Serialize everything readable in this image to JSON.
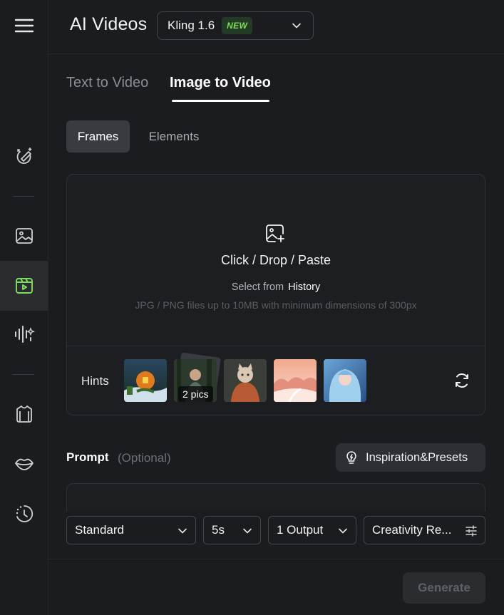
{
  "sidebar": {
    "items": [
      {
        "icon": "menu-icon"
      },
      {
        "icon": "magic-pen-icon"
      },
      {
        "icon": "image-icon"
      },
      {
        "icon": "video-icon",
        "active": true,
        "accent": "#7ee05a"
      },
      {
        "icon": "audio-sparkle-icon"
      },
      {
        "icon": "shirt-icon"
      },
      {
        "icon": "lips-icon"
      },
      {
        "icon": "history-clock-icon"
      }
    ]
  },
  "header": {
    "title": "AI Videos",
    "model": {
      "label": "Kling 1.6",
      "badge": "NEW"
    }
  },
  "mode_tabs": [
    {
      "label": "Text to Video",
      "active": false
    },
    {
      "label": "Image to Video",
      "active": true
    }
  ],
  "sub_tabs": [
    {
      "label": "Frames",
      "active": true
    },
    {
      "label": "Elements",
      "active": false
    }
  ],
  "upload": {
    "title": "Click / Drop / Paste",
    "select_prefix": "Select from",
    "select_link": "History",
    "requirements": "JPG / PNG files up to 10MB with minimum dimensions of 300px"
  },
  "hints": {
    "label": "Hints",
    "thumbnails": [
      {
        "name": "pumpkin-house",
        "badge": ""
      },
      {
        "name": "forest-portrait",
        "badge": "2 pics"
      },
      {
        "name": "cat-portrait",
        "badge": ""
      },
      {
        "name": "pastel-landscape",
        "badge": ""
      },
      {
        "name": "blue-hair-girl",
        "badge": ""
      }
    ]
  },
  "prompt": {
    "label": "Prompt",
    "optional": "(Optional)",
    "inspiration_label": "Inspiration&Presets"
  },
  "options": {
    "mode": "Standard",
    "duration": "5s",
    "outputs": "1 Output",
    "creativity": "Creativity Re..."
  },
  "generate_label": "Generate",
  "colors": {
    "background": "#1b1c1f",
    "accent_green": "#7ee05a",
    "disabled_text": "#5f6065"
  }
}
